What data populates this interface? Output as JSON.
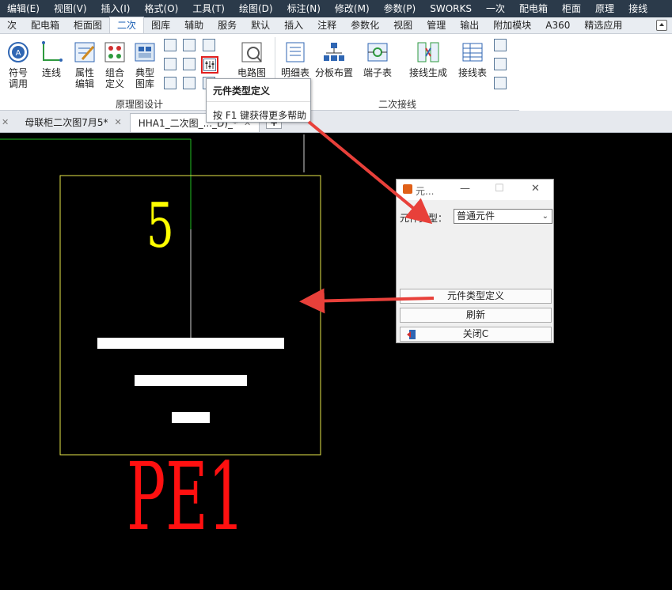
{
  "menubar": [
    "编辑(E)",
    "视图(V)",
    "插入(I)",
    "格式(O)",
    "工具(T)",
    "绘图(D)",
    "标注(N)",
    "修改(M)",
    "参数(P)",
    "SWORKS",
    "一次",
    "配电箱",
    "柜面",
    "原理",
    "接线"
  ],
  "ribbon_tabs": [
    "次",
    "配电箱",
    "柜面图",
    "二次",
    "图库",
    "辅助",
    "服务",
    "默认",
    "插入",
    "注释",
    "参数化",
    "视图",
    "管理",
    "输出",
    "附加模块",
    "A360",
    "精选应用"
  ],
  "ribbon": {
    "buttons": {
      "fuhao": "符号\n调用",
      "lianxian": "连线",
      "shuxing": "属性\n编辑",
      "zuhe": "组合\n定义",
      "dianxing": "典型\n图库",
      "dianlutu": "电路图",
      "mingxi": "明细表",
      "fenban": "分板布置",
      "duanzi": "端子表",
      "jiexian_gen": "接线生成",
      "jiexian_biao": "接线表"
    },
    "panels": {
      "yuanlitu": "原理图设计",
      "erci_jiexian": "二次接线"
    }
  },
  "tooltip": {
    "title": "元件类型定义",
    "help": "按 F1 键获得更多帮助"
  },
  "doc_tabs": {
    "tab1": "母联柜二次图7月5*",
    "tab2": "HHA1_二次图_..._D)_*"
  },
  "canvas": {
    "number": "5",
    "label": "PE1"
  },
  "dialog": {
    "title": "元...",
    "type_label": "元件类型：",
    "type_value": "普通元件",
    "define_button": "元件类型定义",
    "refresh_button": "刷新",
    "close_button": "关闭C"
  },
  "colors": {
    "menubar_bg": "#2b3a4a",
    "canvas_bg": "#000000",
    "number_color": "#ffff00",
    "label_color": "#ff1010",
    "annotation_arrow": "#e8403a"
  }
}
